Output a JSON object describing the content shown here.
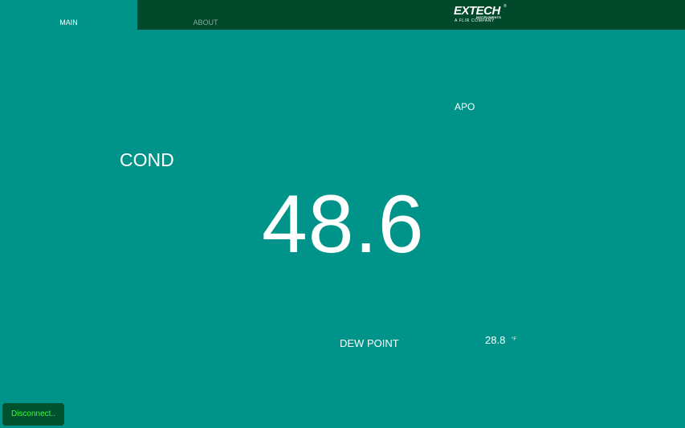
{
  "tabs": {
    "main_label": "MAIN",
    "about_label": "ABOUT"
  },
  "logo": {
    "brand": "EXTECH",
    "registered": "®",
    "instruments": "INSTRUMENTS",
    "tagline": "A FLIR COMPANY"
  },
  "meter": {
    "apo_label": "APO",
    "mode_label": "COND",
    "reading": "48.6",
    "dew_point_label": "DEW POINT",
    "dew_point_value": "28.8",
    "dew_point_unit": "°F"
  },
  "status": {
    "connection_label": "Disconnect.."
  },
  "colors": {
    "background": "#009389",
    "topbar": "#004a2b",
    "status_button": "#00522f",
    "status_text": "#35ff35"
  }
}
